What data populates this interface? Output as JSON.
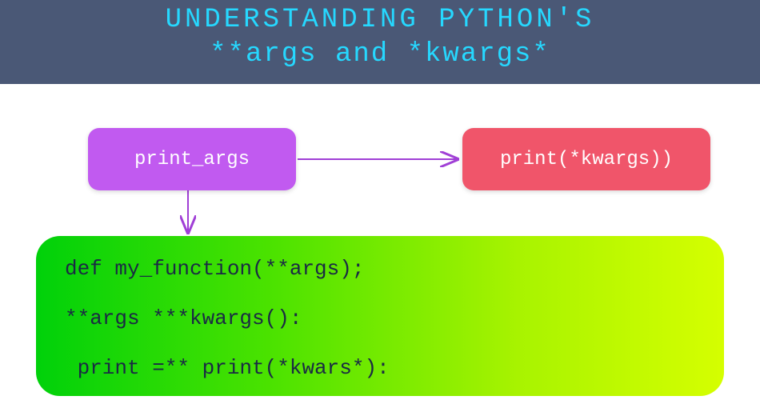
{
  "banner": {
    "line1": "UNDERSTANDING PYTHON'S",
    "line2": "**args and *kwargs*"
  },
  "nodes": {
    "left": {
      "label": "print_args"
    },
    "right": {
      "label": "print(*kwargs))"
    }
  },
  "code": {
    "line1": "def my_function(**args);",
    "line2": "**args ***kwargs():",
    "line3": " print =** print(*kwars*):"
  },
  "arrows": {
    "horizontal": {
      "from": "print_args",
      "to": "print(*kwargs))",
      "color": "#a03fd6"
    },
    "vertical": {
      "from": "print_args",
      "to": "code-block",
      "color": "#a03fd6"
    }
  },
  "colors": {
    "banner_bg": "#4a5876",
    "banner_text": "#26d8ff",
    "purple_node": "#c15af0",
    "red_node": "#f0556a",
    "code_gradient_start": "#00d10a",
    "code_gradient_end": "#d5ff00",
    "arrow": "#a03fd6"
  }
}
